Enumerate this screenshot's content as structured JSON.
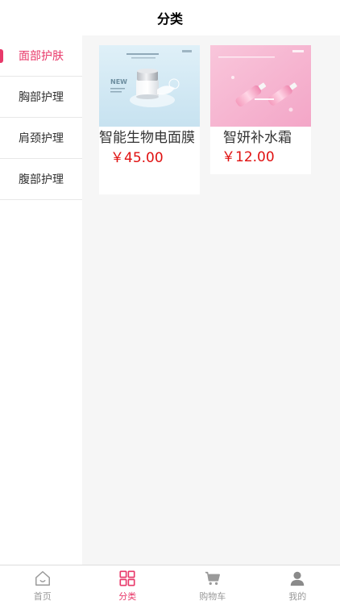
{
  "header": {
    "title": "分类"
  },
  "sidebar": {
    "items": [
      {
        "label": "面部护肤",
        "active": true
      },
      {
        "label": "胸部护理",
        "active": false
      },
      {
        "label": "肩颈护理",
        "active": false
      },
      {
        "label": "腹部护理",
        "active": false
      }
    ]
  },
  "products": [
    {
      "name": "智能生物电面膜",
      "price": "￥45.00",
      "image": "cream-jar-product-image"
    },
    {
      "name": "智妍补水霜",
      "price": "￥12.00",
      "image": "pink-bottles-product-image"
    }
  ],
  "tabbar": {
    "tabs": [
      {
        "label": "首页",
        "icon": "home-icon",
        "active": false
      },
      {
        "label": "分类",
        "icon": "grid-icon",
        "active": true
      },
      {
        "label": "购物车",
        "icon": "cart-icon",
        "active": false
      },
      {
        "label": "我的",
        "icon": "user-icon",
        "active": false
      }
    ]
  },
  "colors": {
    "accent": "#e8396a",
    "price": "#e01111",
    "content_bg": "#f6f6f6"
  }
}
